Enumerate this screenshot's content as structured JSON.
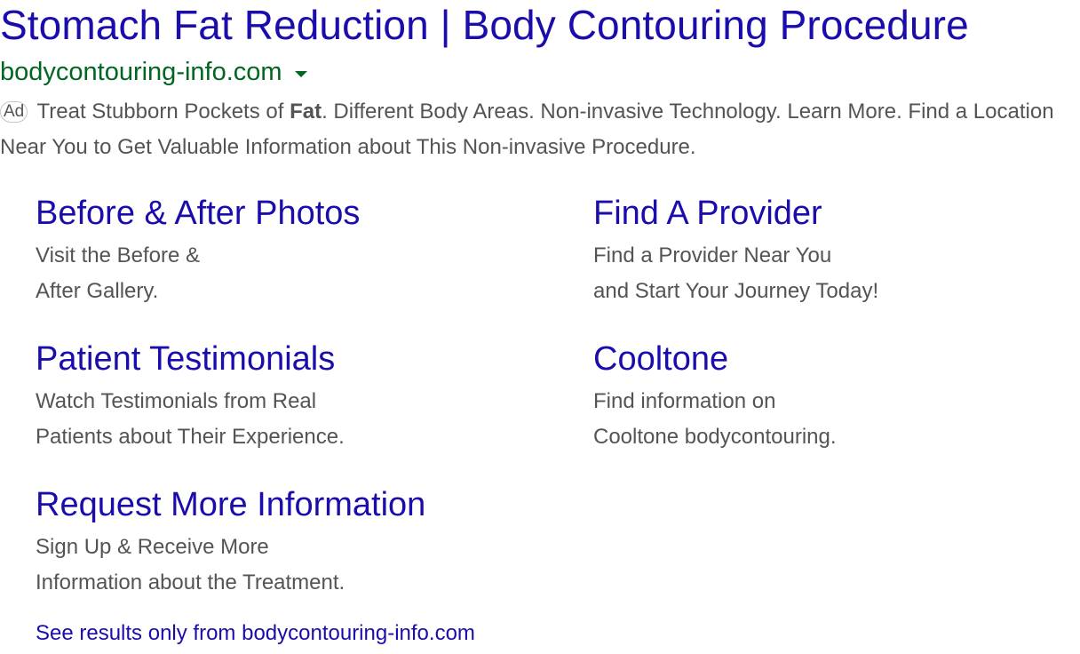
{
  "ad": {
    "title": "Stomach Fat Reduction | Body Contouring Procedure",
    "display_url": "bodycontouring-info.com",
    "url_menu_icon": "dropdown-caret-icon",
    "badge": "Ad",
    "description_part1": " Treat Stubborn Pockets of ",
    "description_bold": "Fat",
    "description_part2": ". Different Body Areas. Non-invasive Technology. Learn More. Find a Location Near You to Get Valuable Information about This Non-invasive Procedure."
  },
  "sitelinks": [
    {
      "title": "Before & After Photos",
      "line1": "Visit the Before &",
      "line2": "After Gallery."
    },
    {
      "title": "Find A Provider",
      "line1": "Find a Provider Near You",
      "line2": "and Start Your Journey Today!"
    },
    {
      "title": "Patient Testimonials",
      "line1": "Watch Testimonials from Real",
      "line2": "Patients about Their Experience."
    },
    {
      "title": "Cooltone",
      "line1": "Find information on",
      "line2": "Cooltone bodycontouring."
    },
    {
      "title": "Request More Information",
      "line1": "Sign Up & Receive More",
      "line2": "Information about the Treatment."
    }
  ],
  "see_results": "See results only from bodycontouring-info.com",
  "colors": {
    "link_blue": "#1a0dab",
    "url_green": "#006621",
    "text_gray": "#545454"
  }
}
